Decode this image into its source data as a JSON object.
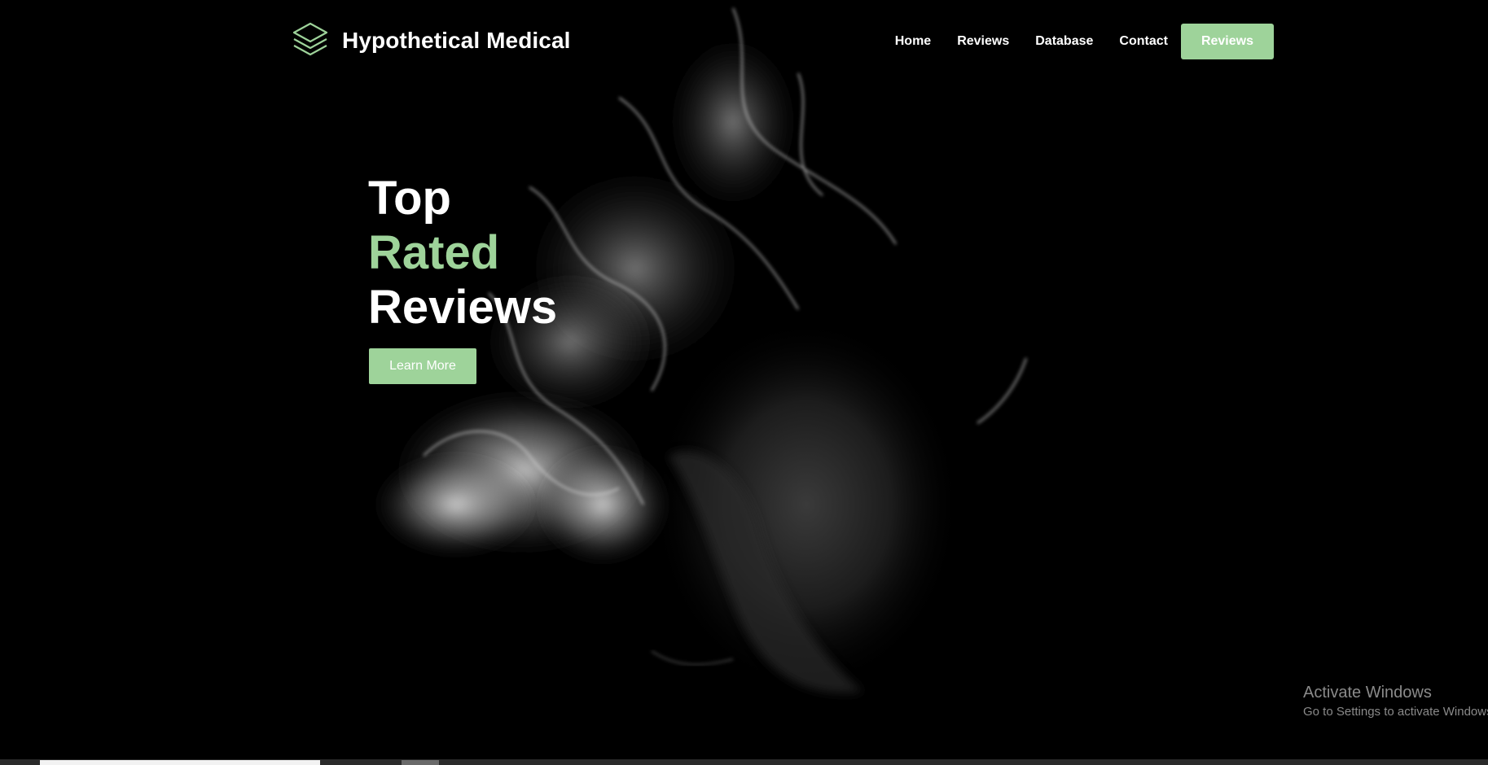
{
  "brand": {
    "name": "Hypothetical Medical",
    "logo_icon": "layers-icon",
    "accent_color": "#9ed39a"
  },
  "nav": {
    "items": [
      "Home",
      "Reviews",
      "Database",
      "Contact"
    ],
    "cta_label": "Reviews"
  },
  "hero": {
    "headline": [
      "Top",
      "Rated",
      "Reviews"
    ],
    "button_label": "Learn More",
    "background": "smoke-portrait-photo"
  },
  "system": {
    "watermark_title": "Activate Windows",
    "watermark_sub": "Go to Settings to activate Windows."
  }
}
